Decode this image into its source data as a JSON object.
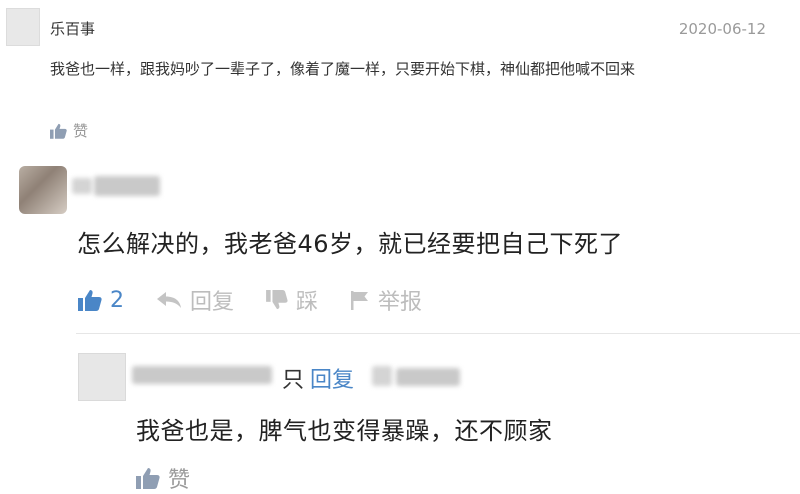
{
  "comment1": {
    "username": "乐百事",
    "date": "2020-06-12",
    "text": "我爸也一样，跟我妈吵了一辈子了，像着了魔一样，只要开始下棋，神仙都把他喊不回来",
    "like_label": "赞"
  },
  "comment2": {
    "text": "怎么解决的，我老爸46岁，就已经要把自己下死了",
    "like_count": "2",
    "reply_label": "回复",
    "dislike_label": "踩",
    "report_label": "举报"
  },
  "reply": {
    "tail_char": "只",
    "reply_word": "回复",
    "text": "我爸也是，脾气也变得暴躁，还不顾家",
    "like_label": "赞"
  },
  "colors": {
    "link_blue": "#4a86c7",
    "muted_gray": "#bdbdbd",
    "text_dark": "#222222"
  },
  "icons": [
    "thumb-up-icon",
    "reply-arrow-icon",
    "thumb-down-icon",
    "flag-icon"
  ]
}
